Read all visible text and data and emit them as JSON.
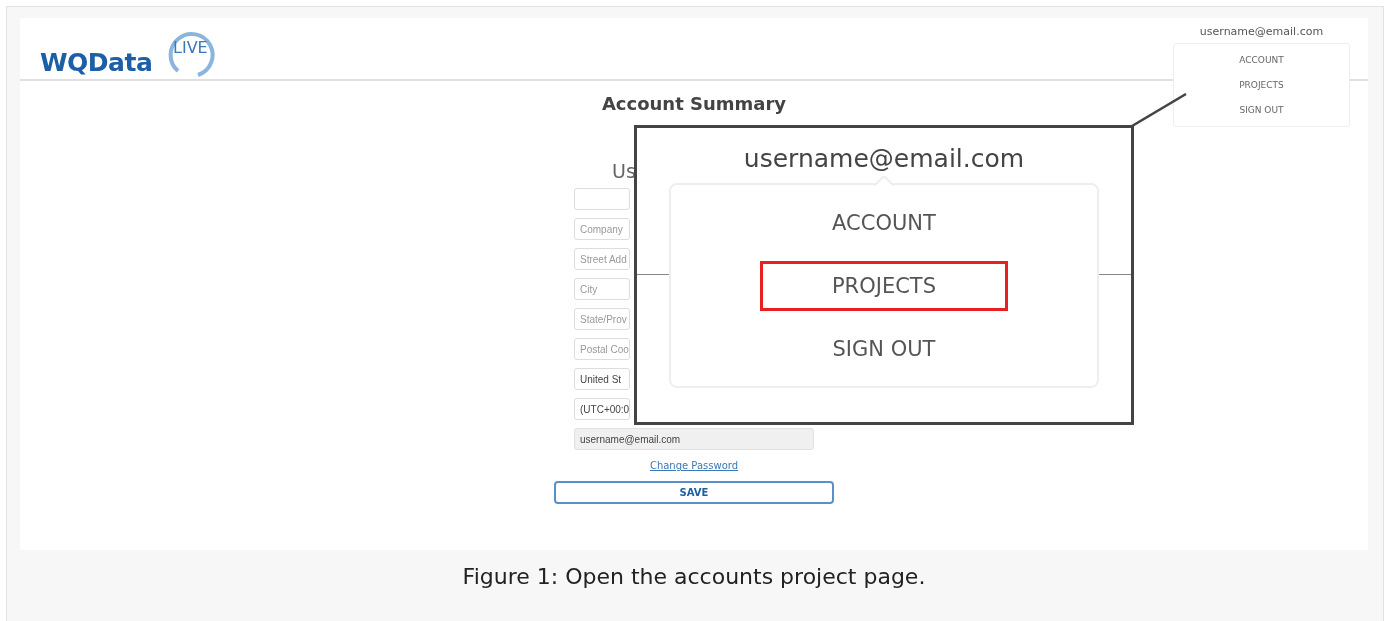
{
  "header": {
    "logo": {
      "text": "WQData",
      "badge": "LIVE"
    },
    "user_menu": {
      "email": "username@email.com",
      "items": [
        {
          "label": "ACCOUNT",
          "selected": false
        },
        {
          "label": "PROJECTS",
          "selected": false
        },
        {
          "label": "SIGN OUT",
          "selected": false
        }
      ]
    }
  },
  "page": {
    "title": "Account Summary",
    "section_heading": "Us",
    "fields": [
      {
        "kind": "empty"
      },
      {
        "kind": "placeholder",
        "text": "Company"
      },
      {
        "kind": "placeholder",
        "text": "Street Add"
      },
      {
        "kind": "placeholder",
        "text": "City"
      },
      {
        "kind": "placeholder",
        "text": "State/Prov"
      },
      {
        "kind": "placeholder",
        "text": "Postal Coo"
      },
      {
        "kind": "value",
        "text": "United St"
      },
      {
        "kind": "value",
        "text": "(UTC+00:0"
      },
      {
        "kind": "value",
        "text": "username@email.com",
        "disabled": true
      }
    ],
    "link": "Change Password",
    "button": "SAVE"
  },
  "callout": {
    "email": "username@email.com",
    "items": [
      {
        "label": "ACCOUNT",
        "highlighted": false
      },
      {
        "label": "PROJECTS",
        "highlighted": true
      },
      {
        "label": "SIGN OUT",
        "highlighted": false
      }
    ]
  },
  "caption": "Figure 1: Open the accounts project page."
}
